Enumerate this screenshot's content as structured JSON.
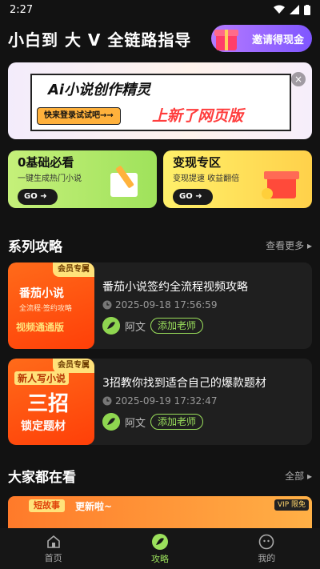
{
  "status_bar": {
    "time": "2:27"
  },
  "header": {
    "title": "小白到 大 V  全链路指导",
    "invite_label": "邀请得现金"
  },
  "banner": {
    "title": "Ai小说创作精灵",
    "login_text": "快来登录试试吧→→",
    "new_text": "上新了网页版"
  },
  "promos": [
    {
      "title": "0基础必看",
      "subtitle": "一键生成热门小说",
      "go": "GO"
    },
    {
      "title": "变现专区",
      "subtitle": "变现提速 收益翻倍",
      "go": "GO"
    }
  ],
  "series_section": {
    "title": "系列攻略",
    "more": "查看更多"
  },
  "articles": [
    {
      "badge": "会员专属",
      "thumb_line1": "番茄小说",
      "thumb_line2": "全流程·签约攻略",
      "thumb_line3": "视频通通版",
      "title": "番茄小说签约全流程视频攻略",
      "time": "2025-09-18 17:56:59",
      "author": "阿文",
      "action": "添加老师"
    },
    {
      "badge": "会员专属",
      "thumb_line1": "新人写小说",
      "thumb_line2": "三招",
      "thumb_line3": "锁定题材",
      "title": "3招教你找到适合自己的爆款题材",
      "time": "2025-09-19 17:32:47",
      "author": "阿文",
      "action": "添加老师"
    }
  ],
  "popular_section": {
    "title": "大家都在看",
    "more": "全部"
  },
  "peek": {
    "tag": "短故事",
    "text": "更新啦~",
    "vip": "VIP 限免"
  },
  "tabs": [
    {
      "label": "首页",
      "icon": "home-icon"
    },
    {
      "label": "攻略",
      "icon": "leaf-icon",
      "active": true
    },
    {
      "label": "我的",
      "icon": "profile-icon"
    }
  ],
  "colors": {
    "accent": "#9be05c",
    "background": "#121212",
    "card": "#1f1f1f"
  }
}
